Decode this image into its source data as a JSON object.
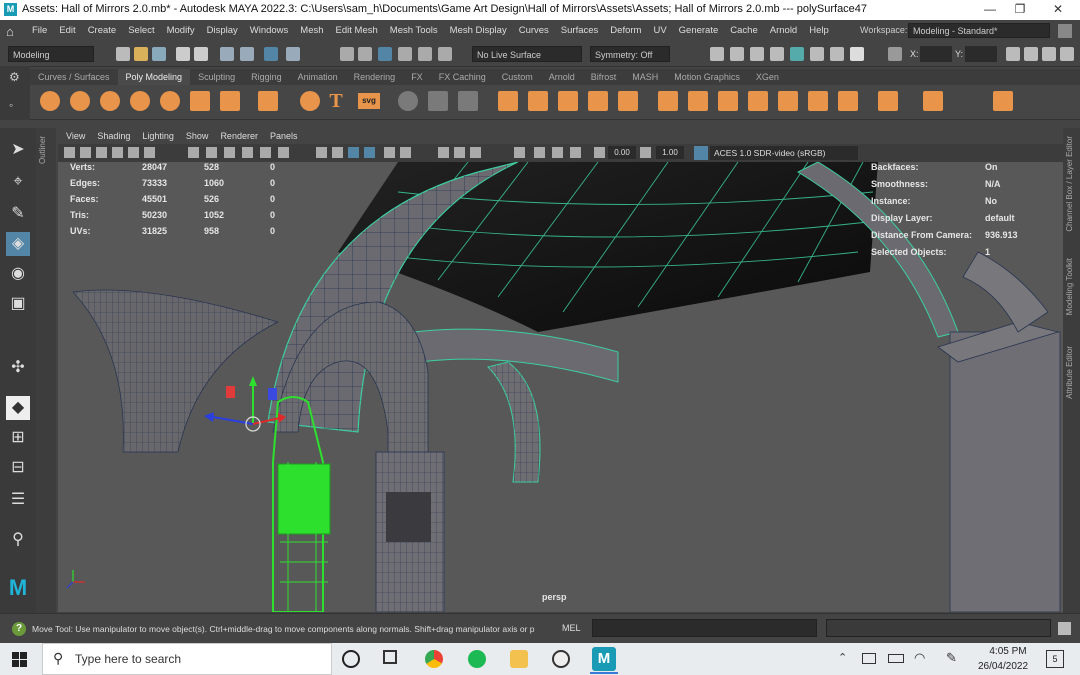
{
  "title_bar": {
    "title": "Assets: Hall of Mirrors 2.0.mb* - Autodesk MAYA 2022.3: C:\\Users\\sam_h\\Documents\\Game Art Design\\Hall of Mirrors\\Assets\\Assets; Hall of Mirrors 2.0.mb   ---   polySurface47",
    "minimize": "—",
    "maximize": "❐",
    "close": "✕"
  },
  "menu": {
    "items": [
      "File",
      "Edit",
      "Create",
      "Select",
      "Modify",
      "Display",
      "Windows",
      "Mesh",
      "Edit Mesh",
      "Mesh Tools",
      "Mesh Display",
      "Curves",
      "Surfaces",
      "Deform",
      "UV",
      "Generate",
      "Cache",
      "Arnold",
      "Help"
    ],
    "workspace_label": "Workspace:",
    "workspace_value": "Modeling - Standard*"
  },
  "status_line": {
    "mode": "Modeling",
    "live_surface": "No Live Surface",
    "symmetry": "Symmetry: Off",
    "x_label": "X:",
    "y_label": "Y:"
  },
  "shelf": {
    "tabs": [
      "Curves / Surfaces",
      "Poly Modeling",
      "Sculpting",
      "Rigging",
      "Animation",
      "Rendering",
      "FX",
      "FX Caching",
      "Custom",
      "Arnold",
      "Bifrost",
      "MASH",
      "Motion Graphics",
      "XGen"
    ],
    "active_tab": "Poly Modeling",
    "text_icon": "T",
    "svg_icon": "svg"
  },
  "left_tabs": {
    "outliner": "Outliner"
  },
  "right_tabs": [
    "Channel Box / Layer Editor",
    "Modeling Toolkit",
    "Attribute Editor"
  ],
  "panel_menu": [
    "View",
    "Shading",
    "Lighting",
    "Show",
    "Renderer",
    "Panels"
  ],
  "panel_bar": {
    "exposure": "0.00",
    "gamma": "1.00",
    "color_space": "ACES 1.0 SDR-video (sRGB)"
  },
  "hud_left": {
    "rows": [
      {
        "label": "Verts:",
        "v1": "28047",
        "v2": "528",
        "v3": "0"
      },
      {
        "label": "Edges:",
        "v1": "73333",
        "v2": "1060",
        "v3": "0"
      },
      {
        "label": "Faces:",
        "v1": "45501",
        "v2": "526",
        "v3": "0"
      },
      {
        "label": "Tris:",
        "v1": "50230",
        "v2": "1052",
        "v3": "0"
      },
      {
        "label": "UVs:",
        "v1": "31825",
        "v2": "958",
        "v3": "0"
      }
    ]
  },
  "hud_right": {
    "rows": [
      {
        "label": "Backfaces:",
        "value": "On"
      },
      {
        "label": "Smoothness:",
        "value": "N/A"
      },
      {
        "label": "Instance:",
        "value": "No"
      },
      {
        "label": "Display Layer:",
        "value": "default"
      },
      {
        "label": "Distance From Camera:",
        "value": "936.913"
      },
      {
        "label": "Selected Objects:",
        "value": "1"
      }
    ]
  },
  "viewport": {
    "camera": "persp"
  },
  "help_line": {
    "text": "Move Tool: Use manipulator to move object(s). Ctrl+middle-drag to move components along normals. Shift+drag manipulator axis or p",
    "mel_label": "MEL"
  },
  "taskbar": {
    "search_placeholder": "Type here to search",
    "time": "4:05 PM",
    "date": "26/04/2022",
    "notification_count": "5"
  },
  "colors": {
    "accent": "#5285a6",
    "selection_green": "#2ee02e",
    "wire_teal": "#3ccfa0",
    "shelf_orange": "#e8944a"
  }
}
